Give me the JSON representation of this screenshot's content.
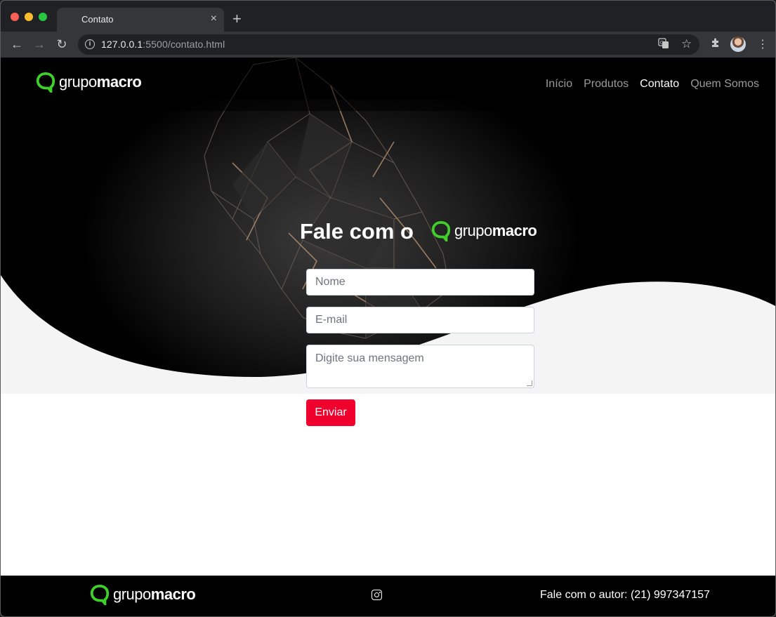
{
  "browser": {
    "tab_title": "Contato",
    "tab_close": "×",
    "new_tab": "+",
    "url_host": "127.0.0.1",
    "url_rest": ":5500/contato.html"
  },
  "header": {
    "logo": {
      "prefix": "grupo",
      "suffix": "macro"
    },
    "nav": [
      {
        "label": "Início",
        "active": false
      },
      {
        "label": "Produtos",
        "active": false
      },
      {
        "label": "Contato",
        "active": true
      },
      {
        "label": "Quem Somos",
        "active": false
      }
    ]
  },
  "hero": {
    "headline": "Fale com o",
    "logo": {
      "prefix": "grupo",
      "suffix": "macro"
    }
  },
  "form": {
    "name_placeholder": "Nome",
    "email_placeholder": "E-mail",
    "message_placeholder": "Digite sua mensagem",
    "submit_label": "Enviar"
  },
  "footer": {
    "logo": {
      "prefix": "grupo",
      "suffix": "macro"
    },
    "contact_text": "Fale com o autor: (21) 997347157"
  },
  "colors": {
    "brand_green": "#3fd12a",
    "submit_red": "#f0002d",
    "hero_bg": "#000000",
    "curve_bg": "#f4f4f4"
  },
  "icons": [
    "back-arrow-icon",
    "forward-arrow-icon",
    "reload-icon",
    "info-icon",
    "translate-icon",
    "star-icon",
    "extensions-icon",
    "menu-icon",
    "instagram-icon"
  ]
}
